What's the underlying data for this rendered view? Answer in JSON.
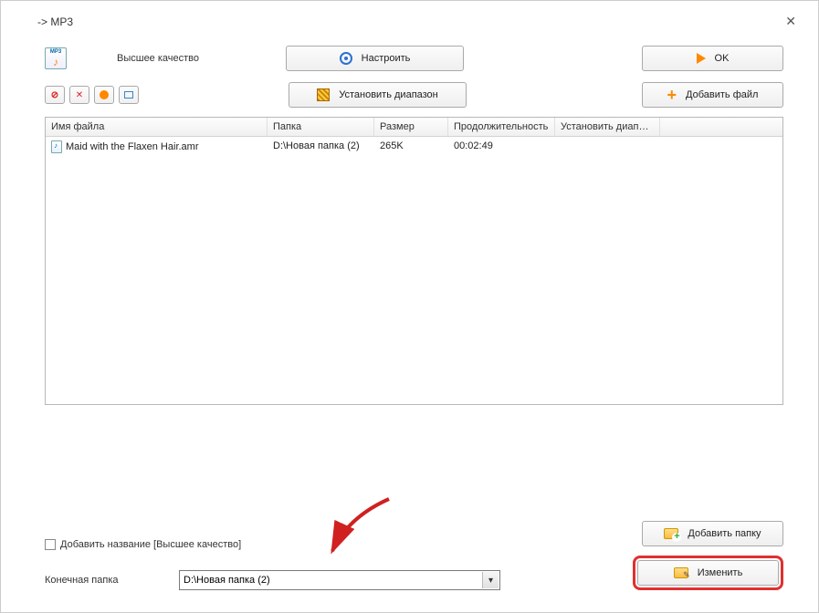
{
  "window": {
    "title": "-> MP3"
  },
  "quality": {
    "label": "Высшее качество"
  },
  "buttons": {
    "settings": "Настроить",
    "set_range": "Установить диапазон",
    "ok": "OK",
    "add_file": "Добавить файл",
    "add_folder": "Добавить папку",
    "change": "Изменить"
  },
  "table": {
    "headers": {
      "name": "Имя файла",
      "folder": "Папка",
      "size": "Размер",
      "duration": "Продолжительность",
      "range": "Установить диапаз..."
    },
    "rows": [
      {
        "name": "Maid with the Flaxen Hair.amr",
        "folder": "D:\\Новая папка (2)",
        "size": "265K",
        "duration": "00:02:49",
        "range": ""
      }
    ]
  },
  "add_name": {
    "label": "Добавить название [Высшее качество]"
  },
  "dest": {
    "label": "Конечная папка",
    "value": "D:\\Новая папка (2)"
  }
}
